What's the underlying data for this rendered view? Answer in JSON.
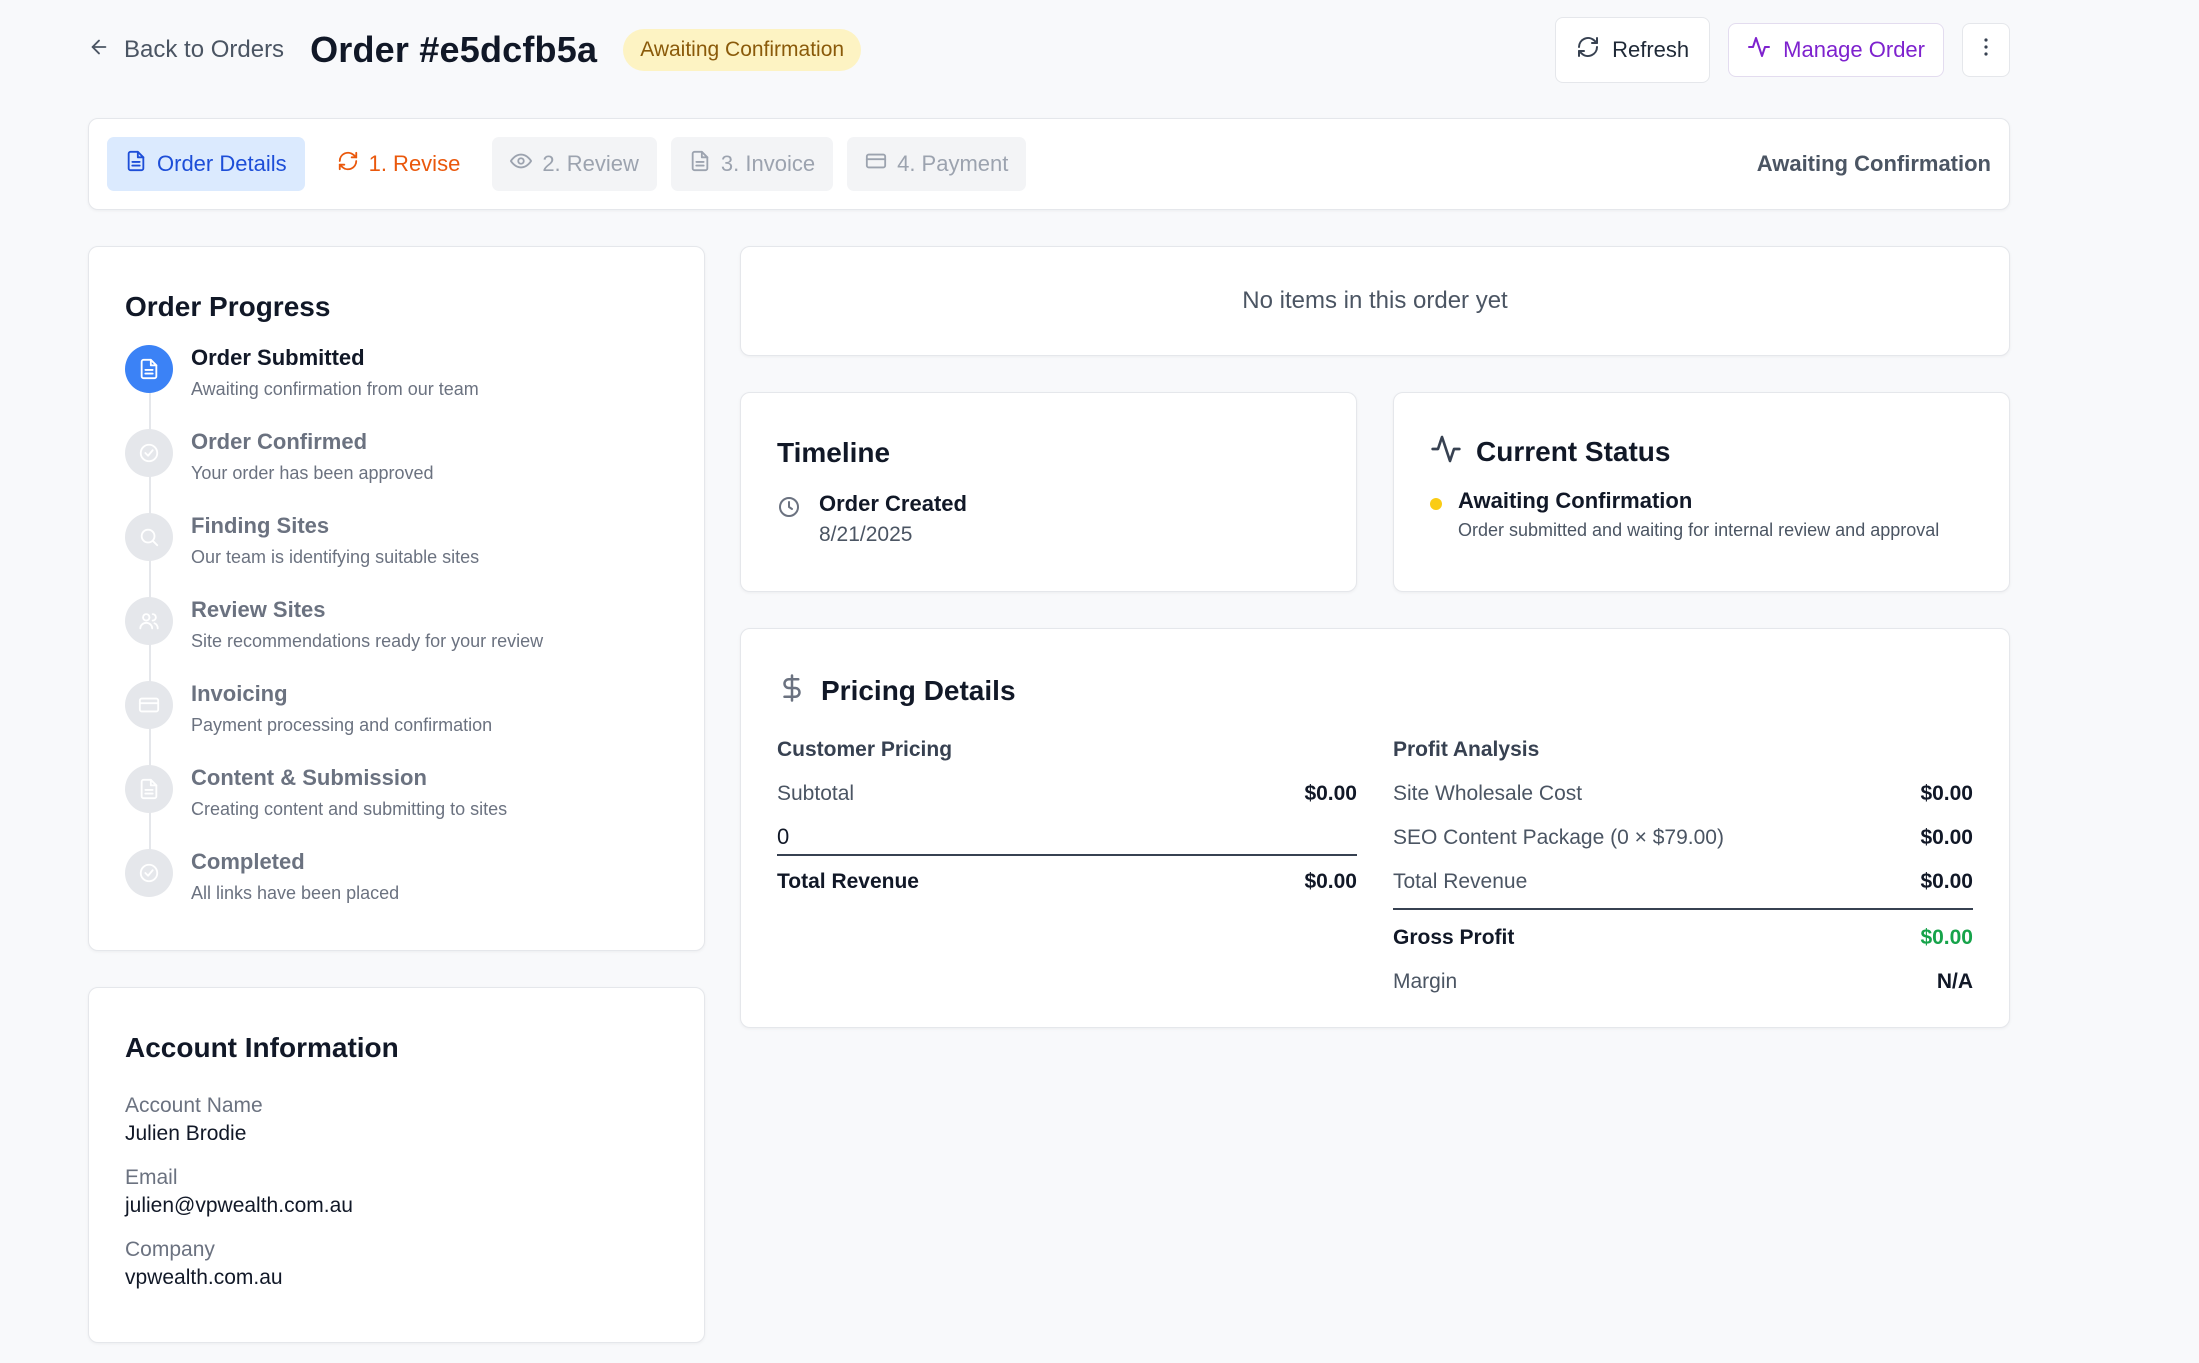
{
  "header": {
    "back_label": "Back to Orders",
    "order_title": "Order #e5dcfb5a",
    "status_badge": "Awaiting Confirmation",
    "refresh_label": "Refresh",
    "manage_label": "Manage Order"
  },
  "tabs": {
    "items": [
      {
        "label": "Order Details",
        "icon": "document-icon",
        "state": "active"
      },
      {
        "label": "1. Revise",
        "icon": "refresh-icon",
        "state": "highlight"
      },
      {
        "label": "2. Review",
        "icon": "eye-icon",
        "state": "disabled"
      },
      {
        "label": "3. Invoice",
        "icon": "document-icon",
        "state": "disabled"
      },
      {
        "label": "4. Payment",
        "icon": "credit-card-icon",
        "state": "disabled"
      }
    ],
    "status_text": "Awaiting Confirmation"
  },
  "progress": {
    "title": "Order Progress",
    "steps": [
      {
        "name": "Order Submitted",
        "desc": "Awaiting confirmation from our team",
        "icon": "document-icon",
        "active": true
      },
      {
        "name": "Order Confirmed",
        "desc": "Your order has been approved",
        "icon": "check-circle-icon",
        "active": false
      },
      {
        "name": "Finding Sites",
        "desc": "Our team is identifying suitable sites",
        "icon": "search-icon",
        "active": false
      },
      {
        "name": "Review Sites",
        "desc": "Site recommendations ready for your review",
        "icon": "users-icon",
        "active": false
      },
      {
        "name": "Invoicing",
        "desc": "Payment processing and confirmation",
        "icon": "credit-card-icon",
        "active": false
      },
      {
        "name": "Content & Submission",
        "desc": "Creating content and submitting to sites",
        "icon": "document-icon",
        "active": false
      },
      {
        "name": "Completed",
        "desc": "All links have been placed",
        "icon": "check-circle-icon",
        "active": false
      }
    ]
  },
  "account": {
    "title": "Account Information",
    "name_label": "Account Name",
    "name_value": "Julien Brodie",
    "email_label": "Email",
    "email_value": "julien@vpwealth.com.au",
    "company_label": "Company",
    "company_value": "vpwealth.com.au"
  },
  "items_empty": "No items in this order yet",
  "timeline": {
    "title": "Timeline",
    "event_name": "Order Created",
    "event_date": "8/21/2025"
  },
  "current_status": {
    "title": "Current Status",
    "name": "Awaiting Confirmation",
    "desc": "Order submitted and waiting for internal review and approval",
    "dot_color": "#facc15"
  },
  "pricing": {
    "title": "Pricing Details",
    "customer": {
      "title": "Customer Pricing",
      "subtotal_label": "Subtotal",
      "subtotal_value": "$0.00",
      "input_value": "0",
      "total_label": "Total Revenue",
      "total_value": "$0.00"
    },
    "profit": {
      "title": "Profit Analysis",
      "rows": [
        {
          "label": "Site Wholesale Cost",
          "value": "$0.00"
        },
        {
          "label": "SEO Content Package (0 × $79.00)",
          "value": "$0.00"
        },
        {
          "label": "Total Revenue",
          "value": "$0.00"
        }
      ],
      "gross_label": "Gross Profit",
      "gross_value": "$0.00",
      "margin_label": "Margin",
      "margin_value": "N/A"
    }
  },
  "colors": {
    "accent_blue": "#3b82f6",
    "revise_orange": "#ea580c",
    "manage_purple": "#7e22ce",
    "profit_green": "#16a34a",
    "badge_bg": "#fdf3c3"
  }
}
